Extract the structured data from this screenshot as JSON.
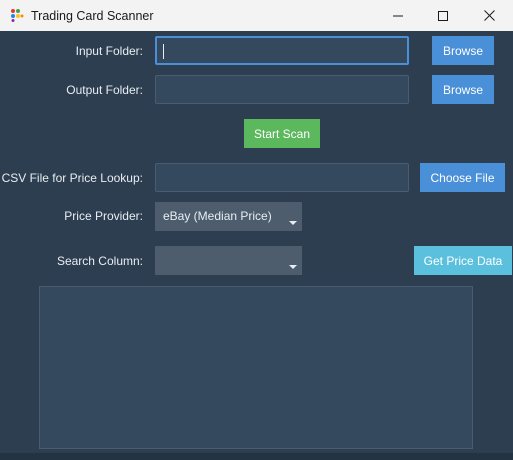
{
  "window": {
    "title": "Trading Card Scanner",
    "icon": "colorful-dots-app-icon",
    "controls": [
      "minimize-icon",
      "maximize-icon",
      "close-icon"
    ]
  },
  "form": {
    "input_folder_label": "Input Folder:",
    "input_folder_value": "",
    "output_folder_label": "Output Folder:",
    "output_folder_value": "",
    "browse_label": "Browse",
    "start_scan_label": "Start Scan",
    "csv_label": "CSV File for Price Lookup:",
    "csv_value": "",
    "choose_file_label": "Choose File",
    "price_provider_label": "Price Provider:",
    "price_provider_value": "eBay (Median Price)",
    "search_column_label": "Search Column:",
    "search_column_value": "",
    "get_price_label": "Get Price Data"
  },
  "results": {
    "text": ""
  },
  "colors": {
    "background": "#2c3e50",
    "field": "#34495e",
    "blue_button": "#4a90d9",
    "green_button": "#5cb85c",
    "teal_button": "#5bc0de"
  }
}
